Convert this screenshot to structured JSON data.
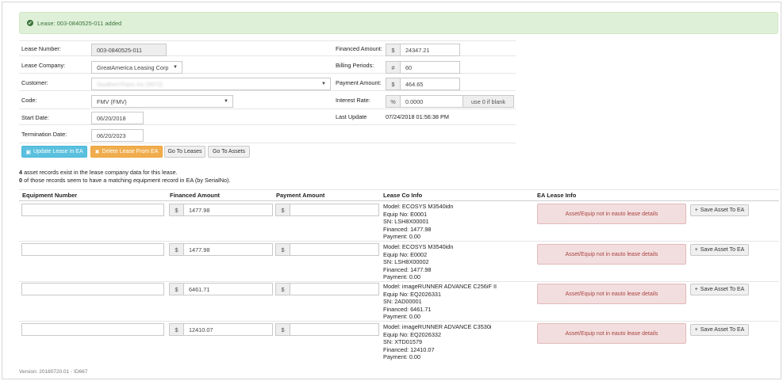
{
  "alert": {
    "text": "Lease: 003-0840525-011 added"
  },
  "form": {
    "lease_number_label": "Lease Number:",
    "lease_number_value": "003-0840525-011",
    "lease_company_label": "Lease Company:",
    "lease_company_value": "GreatAmerica Leasing Corp",
    "customer_label": "Customer:",
    "customer_value": "SouthernTrans Inc (5572)",
    "code_label": "Code:",
    "code_value": "FMV (FMV)",
    "start_date_label": "Start Date:",
    "start_date_value": "06/20/2018",
    "termination_date_label": "Termination Date:",
    "termination_date_value": "06/20/2023",
    "financed_amount_label": "Financed Amount:",
    "financed_amount_prefix": "$",
    "financed_amount_value": "24347.21",
    "billing_periods_label": "Billing Periods:",
    "billing_periods_prefix": "#",
    "billing_periods_value": "60",
    "payment_amount_label": "Payment Amount:",
    "payment_amount_prefix": "$",
    "payment_amount_value": "464.65",
    "interest_rate_label": "Interest Rate:",
    "interest_rate_prefix": "%",
    "interest_rate_value": "0.0000",
    "interest_rate_suffix": "use 0 if blank",
    "last_update_label": "Last Update",
    "last_update_value": "07/24/2018 01:56:38 PM"
  },
  "actions": {
    "update_label": "Update Lease In EA",
    "delete_label": "Delete Lease From EA",
    "goto_leases_label": "Go To Leases",
    "goto_assets_label": "Go To Assets"
  },
  "summary": {
    "count1": "4",
    "line1": " asset records exist in the lease company data for this lease.",
    "count2": "0",
    "line2": " of those records seem to have a matching equipment record in EA (by SerialNo)."
  },
  "table": {
    "headers": [
      "Equipment Number",
      "Financed Amount",
      "Payment Amount",
      "Lease Co Info",
      "EA Lease Info"
    ],
    "currency_prefix": "$",
    "rows": [
      {
        "financed": "1477.98",
        "model": "Model: ECOSYS M3540idn",
        "equip": "Equip No: E0001",
        "sn": "SN: LSH8X00001",
        "fin": "Financed: 1477.98",
        "pay": "Payment: 0.00",
        "ea_status": "Asset/Equip not in eauto lease details",
        "save_label": "Save Asset To EA"
      },
      {
        "financed": "1477.98",
        "model": "Model: ECOSYS M3540idn",
        "equip": "Equip No: E0002",
        "sn": "SN: LSH8X00002",
        "fin": "Financed: 1477.98",
        "pay": "Payment: 0.00",
        "ea_status": "Asset/Equip not in eauto lease details",
        "save_label": "Save Asset To EA"
      },
      {
        "financed": "6461.71",
        "model": "Model: imageRUNNER ADVANCE C256iF II",
        "equip": "Equip No: EQ2026331",
        "sn": "SN: 2AD00001",
        "fin": "Financed: 6461.71",
        "pay": "Payment: 0.00",
        "ea_status": "Asset/Equip not in eauto lease details",
        "save_label": "Save Asset To EA"
      },
      {
        "financed": "12410.07",
        "model": "Model: imageRUNNER ADVANCE C3530i",
        "equip": "Equip No: EQ2026332",
        "sn": "SN: XTD01579",
        "fin": "Financed: 12410.07",
        "pay": "Payment: 0.00",
        "ea_status": "Asset/Equip not in eauto lease details",
        "save_label": "Save Asset To EA"
      }
    ]
  },
  "footer": {
    "version": "Version: 20180720.01 - ID667"
  }
}
